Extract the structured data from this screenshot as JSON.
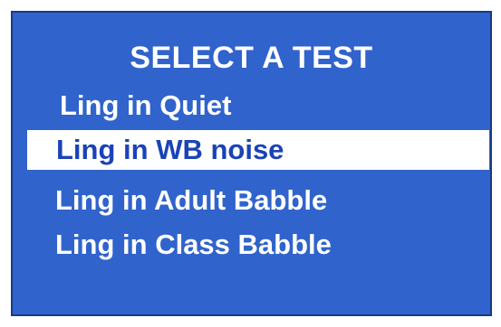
{
  "title": "SELECT A TEST",
  "menu": {
    "items": [
      {
        "label": "Ling in Quiet",
        "selected": false
      },
      {
        "label": "Ling in WB noise",
        "selected": true
      },
      {
        "label": "Ling in Adult Babble",
        "selected": false
      },
      {
        "label": "Ling in Class Babble",
        "selected": false
      }
    ]
  },
  "colors": {
    "panel_background": "#3063cc",
    "panel_border": "#173a85",
    "text": "#ffffff",
    "selected_background": "#ffffff",
    "selected_text": "#1a43b8"
  }
}
